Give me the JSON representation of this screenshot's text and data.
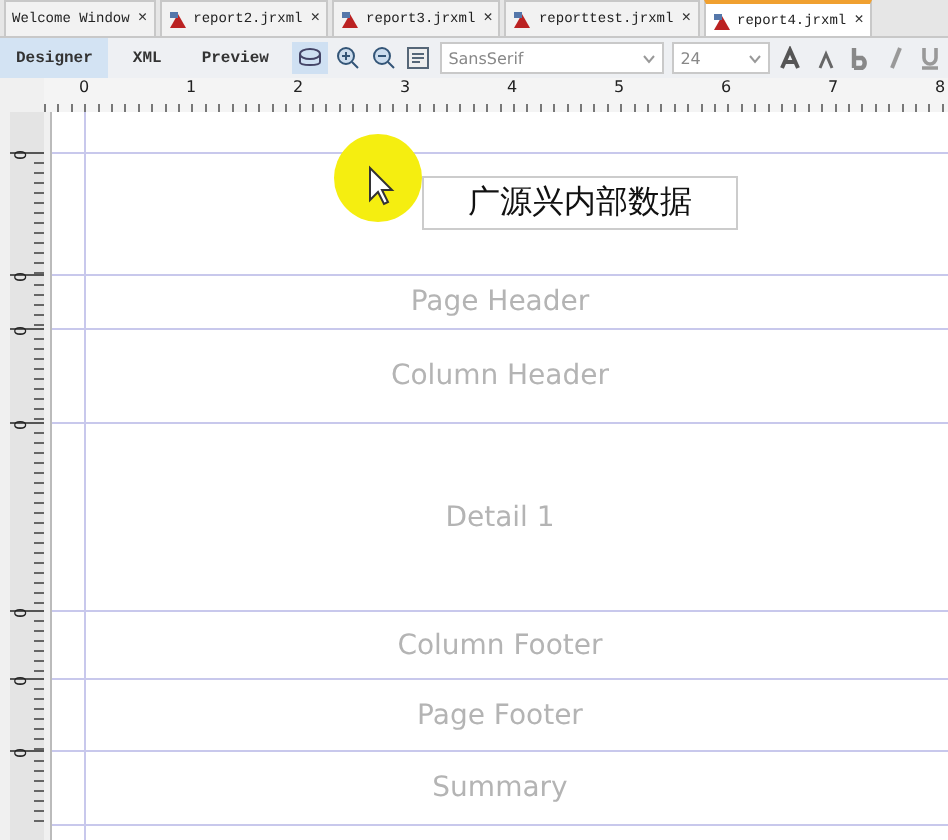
{
  "tabs": [
    {
      "label": "Welcome Window",
      "close": "×",
      "icon": false,
      "selected": false
    },
    {
      "label": "report2.jrxml",
      "close": "×",
      "icon": true,
      "selected": false
    },
    {
      "label": "report3.jrxml",
      "close": "×",
      "icon": true,
      "selected": false
    },
    {
      "label": "reporttest.jrxml",
      "close": "×",
      "icon": true,
      "selected": false
    },
    {
      "label": "report4.jrxml",
      "close": "×",
      "icon": true,
      "selected": true
    }
  ],
  "views": [
    {
      "label": "Designer",
      "selected": true
    },
    {
      "label": "XML",
      "selected": false
    },
    {
      "label": "Preview",
      "selected": false
    }
  ],
  "font": {
    "family": "SansSerif",
    "size": "24"
  },
  "ruler": [
    "0",
    "1",
    "2",
    "3",
    "4",
    "5",
    "6",
    "7",
    "8"
  ],
  "bands": [
    {
      "kind": "title",
      "ruler_label": "0",
      "field": "广源兴内部数据"
    },
    {
      "kind": "page_header",
      "label": "Page Header",
      "ruler_label": "0"
    },
    {
      "kind": "column_header",
      "label": "Column Header",
      "ruler_label": "0"
    },
    {
      "kind": "detail",
      "label": "Detail 1",
      "ruler_label": "0"
    },
    {
      "kind": "column_footer",
      "label": "Column Footer",
      "ruler_label": "0"
    },
    {
      "kind": "page_footer",
      "label": "Page Footer",
      "ruler_label": "0"
    },
    {
      "kind": "summary",
      "label": "Summary",
      "ruler_label": "0"
    }
  ]
}
